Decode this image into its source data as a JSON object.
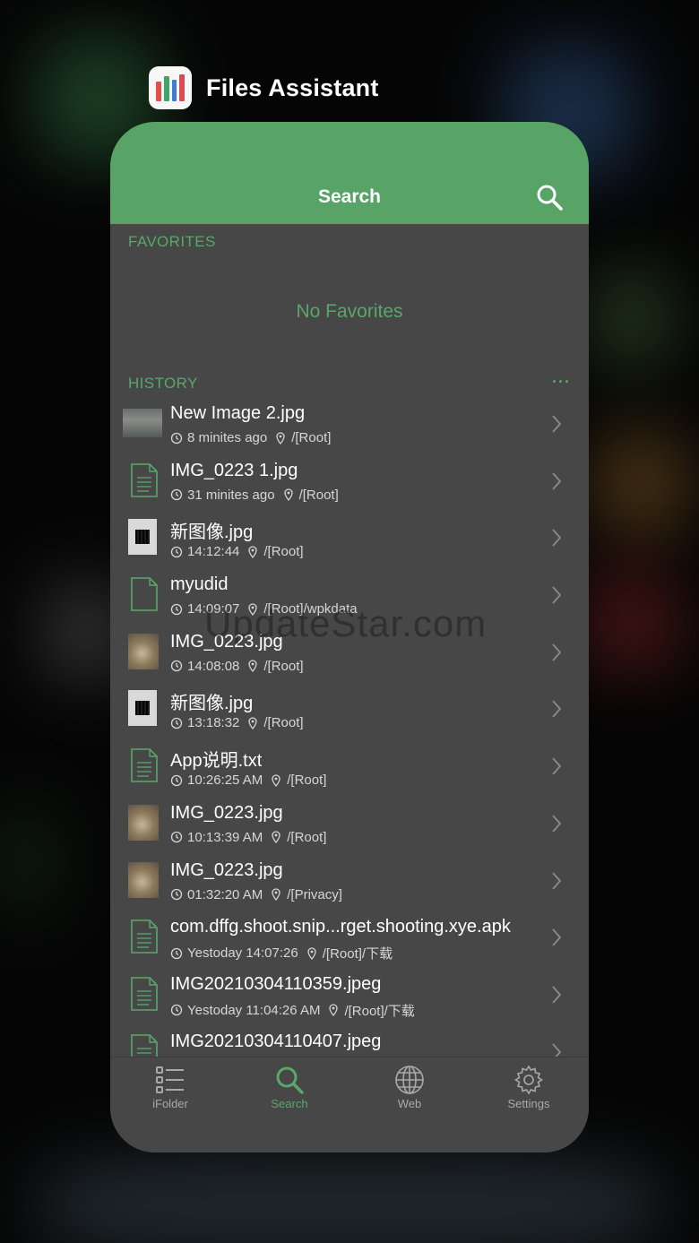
{
  "app_switcher": {
    "app_name": "Files Assistant",
    "icon_colors": [
      "#e0514a",
      "#3fa467",
      "#3d7bd6",
      "#d94a55"
    ]
  },
  "navbar": {
    "title": "Search",
    "search_icon": "search-icon",
    "color": "#57a466"
  },
  "favorites": {
    "header": "FAVORITES",
    "empty_text": "No Favorites"
  },
  "history": {
    "header": "HISTORY",
    "more_label": "···",
    "items": [
      {
        "name": "New Image 2.jpg",
        "time": "8 minites ago",
        "location": "/[Root]",
        "thumb": "photo"
      },
      {
        "name": "IMG_0223 1.jpg",
        "time": "31 minites ago",
        "location": "/[Root]",
        "thumb": "doc"
      },
      {
        "name": "新图像.jpg",
        "time": "14:12:44",
        "location": "/[Root]",
        "thumb": "qr"
      },
      {
        "name": "myudid",
        "time": "14:09:07",
        "location": "/[Root]/wpkdata",
        "thumb": "blank"
      },
      {
        "name": "IMG_0223.jpg",
        "time": "14:08:08",
        "location": "/[Root]",
        "thumb": "cat"
      },
      {
        "name": "新图像.jpg",
        "time": "13:18:32",
        "location": "/[Root]",
        "thumb": "qr"
      },
      {
        "name": "App说明.txt",
        "time": "10:26:25 AM",
        "location": "/[Root]",
        "thumb": "doc"
      },
      {
        "name": "IMG_0223.jpg",
        "time": "10:13:39 AM",
        "location": "/[Root]",
        "thumb": "cat"
      },
      {
        "name": "IMG_0223.jpg",
        "time": "01:32:20 AM",
        "location": "/[Privacy]",
        "thumb": "cat"
      },
      {
        "name": "com.dffg.shoot.snip...rget.shooting.xye.apk",
        "time": "Yestoday 14:07:26",
        "location": "/[Root]/下载",
        "thumb": "doc"
      },
      {
        "name": "IMG20210304110359.jpeg",
        "time": "Yestoday 11:04:26 AM",
        "location": "/[Root]/下载",
        "thumb": "doc"
      },
      {
        "name": "IMG20210304110407.jpeg",
        "time": "",
        "location": "",
        "thumb": "doc"
      }
    ]
  },
  "tabbar": {
    "tabs": [
      {
        "label": "iFolder",
        "icon": "folder-list-icon",
        "active": false
      },
      {
        "label": "Search",
        "icon": "search-icon",
        "active": true
      },
      {
        "label": "Web",
        "icon": "globe-icon",
        "active": false
      },
      {
        "label": "Settings",
        "icon": "gear-icon",
        "active": false
      }
    ],
    "active_color": "#58a868",
    "inactive_color": "#a9a9a9"
  },
  "watermark": "UpdateStar.com"
}
